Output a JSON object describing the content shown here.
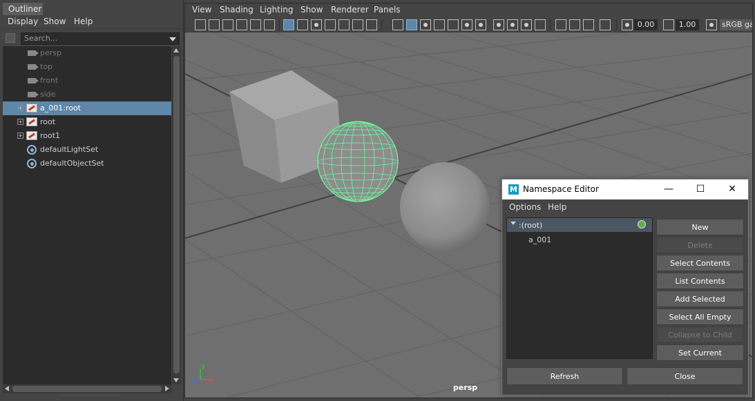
{
  "outliner": {
    "tab_label": "Outliner",
    "menu": [
      "Display",
      "Show",
      "Help"
    ],
    "search_placeholder": "Search...",
    "items": [
      {
        "label": "persp",
        "icon": "camera-icon",
        "dim": true,
        "selected": false
      },
      {
        "label": "top",
        "icon": "camera-icon",
        "dim": true,
        "selected": false
      },
      {
        "label": "front",
        "icon": "camera-icon",
        "dim": true,
        "selected": false
      },
      {
        "label": "side",
        "icon": "camera-icon",
        "dim": true,
        "selected": false
      },
      {
        "label": "a_001:root",
        "icon": "transform-icon",
        "dim": false,
        "selected": true,
        "expandable": true
      },
      {
        "label": "root",
        "icon": "transform-icon",
        "dim": false,
        "selected": false,
        "expandable": true
      },
      {
        "label": "root1",
        "icon": "transform-icon",
        "dim": false,
        "selected": false,
        "expandable": true
      },
      {
        "label": "defaultLightSet",
        "icon": "set-icon",
        "dim": false,
        "selected": false
      },
      {
        "label": "defaultObjectSet",
        "icon": "set-icon",
        "dim": false,
        "selected": false
      }
    ]
  },
  "viewport": {
    "menu": [
      "View",
      "Shading",
      "Lighting",
      "Show",
      "Renderer",
      "Panels"
    ],
    "exposure_value": "0.00",
    "gamma_value": "1.00",
    "colorspace_label": "sRGB ga",
    "camera_label": "persp",
    "axis_labels": {
      "x": "x",
      "y": "y",
      "z": "z"
    }
  },
  "namespace_editor": {
    "title": "Namespace Editor",
    "window_buttons": {
      "minimize": "—",
      "maximize": "☐",
      "close": "✕"
    },
    "menu": [
      "Options",
      "Help"
    ],
    "tree": {
      "root_label": ":(root)",
      "child_label": "a_001"
    },
    "buttons": [
      {
        "label": "New",
        "enabled": true
      },
      {
        "label": "Delete",
        "enabled": false
      },
      {
        "label": "Select Contents",
        "enabled": true
      },
      {
        "label": "List Contents",
        "enabled": true
      },
      {
        "label": "Add Selected",
        "enabled": true
      },
      {
        "label": "Select All Empty",
        "enabled": true
      },
      {
        "label": "Collapse to Child",
        "enabled": false
      },
      {
        "label": "Set Current",
        "enabled": true
      }
    ],
    "refresh_label": "Refresh",
    "close_label": "Close"
  },
  "colors": {
    "selection": "#5d86a8",
    "wireframe_highlight": "#66ff99",
    "current_namespace_dot": "#6aa84f"
  }
}
